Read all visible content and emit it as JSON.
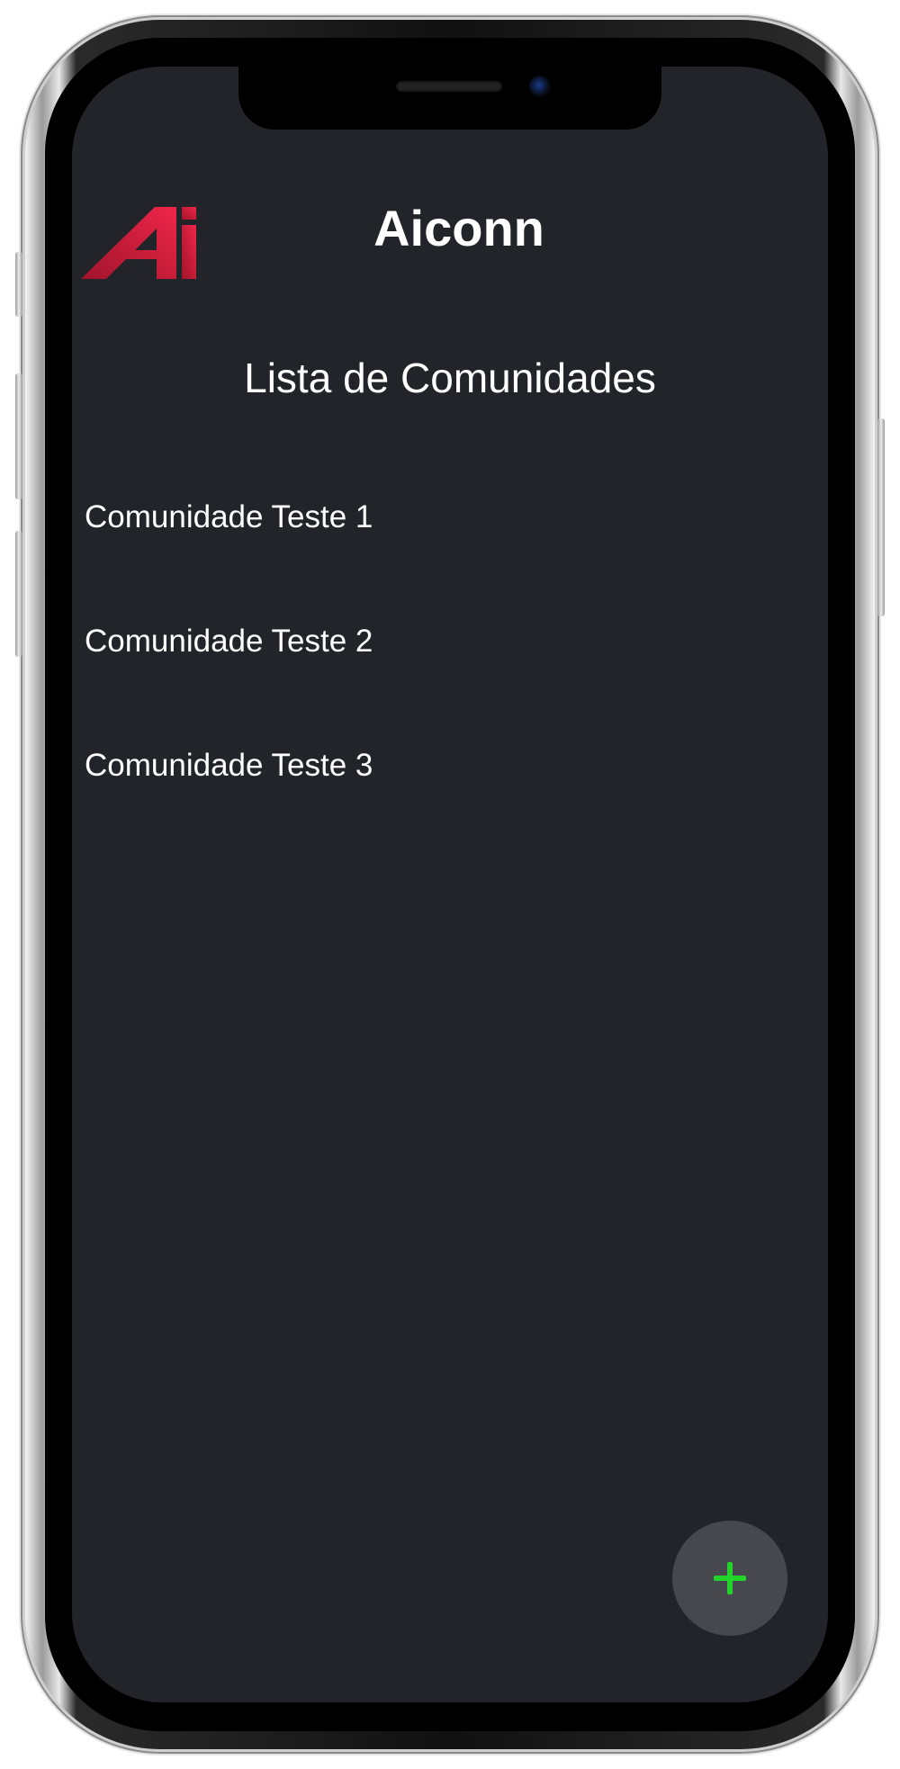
{
  "app": {
    "title": "Aiconn",
    "logo_icon": "aiconn-logo-icon",
    "brand_color": "#e3203f"
  },
  "page": {
    "title": "Lista de Comunidades"
  },
  "communities": [
    {
      "label": "Comunidade Teste 1"
    },
    {
      "label": "Comunidade Teste 2"
    },
    {
      "label": "Comunidade Teste 3"
    }
  ],
  "fab": {
    "icon": "plus-icon",
    "icon_color": "#22d32a"
  },
  "theme": {
    "background": "#22242a",
    "text": "#ffffff",
    "fab_background": "#47484d"
  }
}
